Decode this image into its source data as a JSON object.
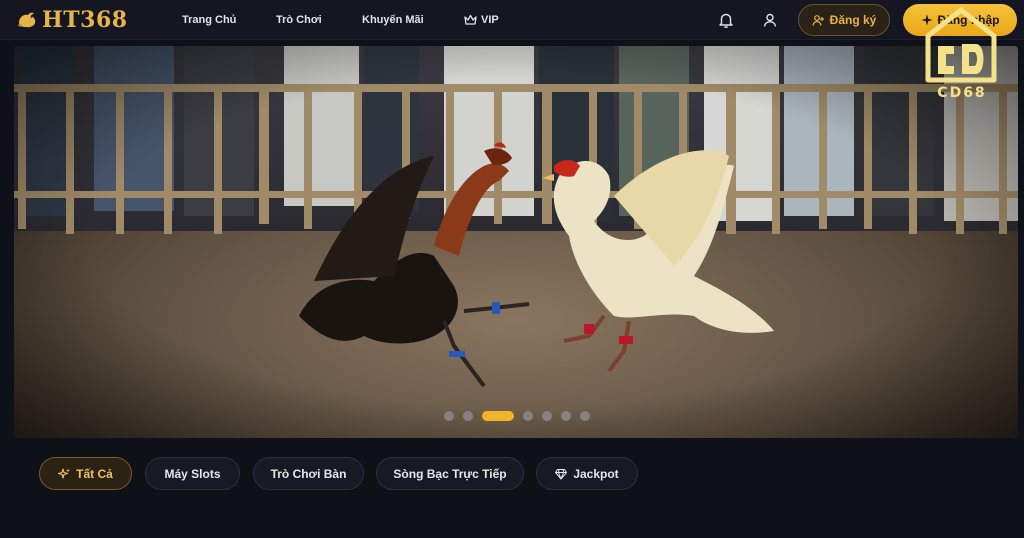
{
  "brand": {
    "name": "HT368"
  },
  "nav": {
    "items": [
      {
        "label": "Trang Chủ"
      },
      {
        "label": "Trò Chơi"
      },
      {
        "label": "Khuyến Mãi"
      },
      {
        "label": "VIP",
        "icon": "crown-icon"
      }
    ]
  },
  "header_actions": {
    "notifications_icon": "bell-icon",
    "account_icon": "user-icon",
    "register_label": "Đăng ký",
    "login_label": "Đăng nhập"
  },
  "watermark": {
    "text": "CD68"
  },
  "banner": {
    "slide_count": 7,
    "active_slide": 3
  },
  "categories": [
    {
      "label": "Tất Cả",
      "icon": "sparkle-icon",
      "active": true
    },
    {
      "label": "Máy Slots",
      "active": false
    },
    {
      "label": "Trò Chơi Bàn",
      "active": false
    },
    {
      "label": "Sòng Bạc Trực Tiếp",
      "active": false
    },
    {
      "label": "Jackpot",
      "icon": "diamond-icon",
      "active": false
    }
  ],
  "colors": {
    "accent": "#f2b52a",
    "background": "#0f1119",
    "header": "#141722"
  }
}
